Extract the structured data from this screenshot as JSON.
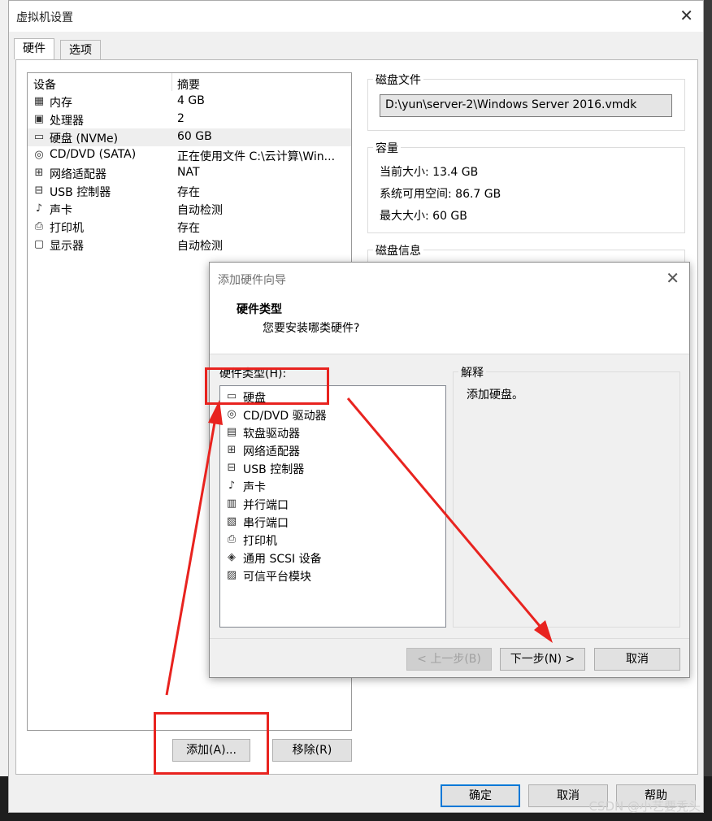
{
  "main_window": {
    "title": "虚拟机设置",
    "tabs": [
      {
        "label": "硬件"
      },
      {
        "label": "选项"
      }
    ],
    "device_table": {
      "headers": {
        "device": "设备",
        "summary": "摘要"
      },
      "rows": [
        {
          "name": "内存",
          "summary": "4 GB",
          "icon": "memory-icon"
        },
        {
          "name": "处理器",
          "summary": "2",
          "icon": "cpu-icon"
        },
        {
          "name": "硬盘 (NVMe)",
          "summary": "60 GB",
          "icon": "hard-disk-icon"
        },
        {
          "name": "CD/DVD (SATA)",
          "summary": "正在使用文件 C:\\云计算\\Win...",
          "icon": "cd-icon"
        },
        {
          "name": "网络适配器",
          "summary": "NAT",
          "icon": "network-icon"
        },
        {
          "name": "USB 控制器",
          "summary": "存在",
          "icon": "usb-icon"
        },
        {
          "name": "声卡",
          "summary": "自动检测",
          "icon": "sound-icon"
        },
        {
          "name": "打印机",
          "summary": "存在",
          "icon": "printer-icon"
        },
        {
          "name": "显示器",
          "summary": "自动检测",
          "icon": "monitor-icon"
        }
      ],
      "selected_index": 2
    },
    "disk_file": {
      "title": "磁盘文件",
      "value": "D:\\yun\\server-2\\Windows Server 2016.vmdk"
    },
    "capacity": {
      "title": "容量",
      "current_size": "当前大小: 13.4 GB",
      "available_space": "系统可用空间: 86.7 GB",
      "max_size": "最大大小: 60 GB"
    },
    "disk_info": {
      "title": "磁盘信息"
    },
    "buttons": {
      "add": "添加(A)...",
      "remove": "移除(R)",
      "ok": "确定",
      "cancel": "取消",
      "help": "帮助"
    }
  },
  "wizard": {
    "title": "添加硬件向导",
    "heading": "硬件类型",
    "question": "您要安装哪类硬件?",
    "list_label": "硬件类型(H):",
    "items": [
      {
        "name": "硬盘",
        "icon": "hard-disk-icon"
      },
      {
        "name": "CD/DVD 驱动器",
        "icon": "cd-icon"
      },
      {
        "name": "软盘驱动器",
        "icon": "floppy-icon"
      },
      {
        "name": "网络适配器",
        "icon": "network-icon"
      },
      {
        "name": "USB 控制器",
        "icon": "usb-icon"
      },
      {
        "name": "声卡",
        "icon": "sound-icon"
      },
      {
        "name": "并行端口",
        "icon": "parallel-port-icon"
      },
      {
        "name": "串行端口",
        "icon": "serial-port-icon"
      },
      {
        "name": "打印机",
        "icon": "printer-icon"
      },
      {
        "name": "通用 SCSI 设备",
        "icon": "scsi-icon"
      },
      {
        "name": "可信平台模块",
        "icon": "tpm-icon"
      }
    ],
    "explain_title": "解释",
    "explain_text": "添加硬盘。",
    "buttons": {
      "back": "< 上一步(B)",
      "next": "下一步(N) >",
      "cancel": "取消"
    }
  },
  "watermark": "CSDN @小艺要秃头",
  "annotation_color": "#e8231f",
  "accent_color": "#0078d7"
}
